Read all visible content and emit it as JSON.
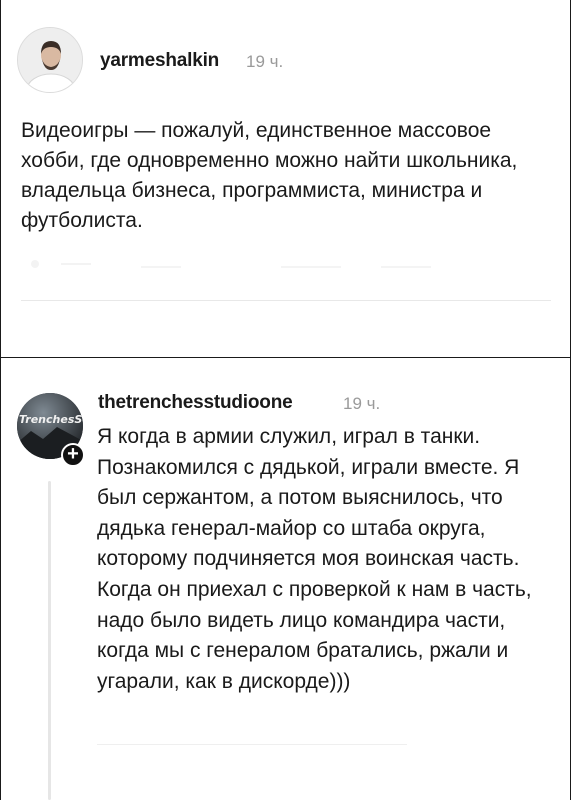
{
  "post": {
    "username": "yarmeshalkin",
    "time": "19 ч.",
    "text": "Видеоигры — пожалуй, единственное массовое хобби, где одновременно можно найти школьника, владельца бизнеса, программиста, министра и футболиста.",
    "avatar_icon": "person-avatar-icon"
  },
  "reply": {
    "username": "thetrenchesstudioone",
    "time": "19 ч.",
    "avatar_label": "TrenchesSt",
    "text": "Я когда в армии служил, играл в танки. Познакомился с дядькой, играли вместе. Я был сержантом, а потом выяснилось, что дядька генерал-майор со штаба округа, которому подчиняется моя воинская часть. Когда он приехал с проверкой к нам в часть, надо было видеть лицо командира части, когда мы с генералом братались, ржали и угарали, как в дискорде)))",
    "follow_badge": "+"
  },
  "colors": {
    "text": "#1a1a1a",
    "muted": "#9a9a9a",
    "thread_line": "#e6e6e6"
  }
}
